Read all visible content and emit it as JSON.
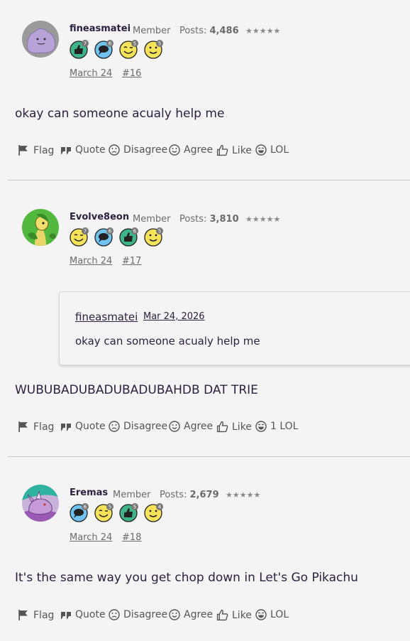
{
  "action_labels": {
    "flag": "Flag",
    "quote": "Quote",
    "disagree": "Disagree",
    "agree": "Agree",
    "like": "Like"
  },
  "icon_names": [
    "flag-icon",
    "quote-icon",
    "frown-icon",
    "smile-icon",
    "thumbs-up-icon",
    "laugh-icon"
  ],
  "posts": [
    {
      "username": "fineasmatei",
      "role": "Member",
      "posts_label": "Posts:",
      "posts_count": "4,486",
      "stars": "★★★★★",
      "badges": [
        {
          "kind": "thumbs",
          "color": "#3fb48a",
          "count": "7"
        },
        {
          "kind": "speech",
          "color": "#6fc3f0",
          "count": "6"
        },
        {
          "kind": "wink",
          "color": "#f7e35a",
          "count": "5"
        },
        {
          "kind": "smile",
          "color": "#f7e35a",
          "count": "5"
        }
      ],
      "date": "March 24",
      "number": "#16",
      "content": "okay can someone acualy help me",
      "lol_label": "LOL"
    },
    {
      "username": "Evolve8eon",
      "role": "Member",
      "posts_label": "Posts:",
      "posts_count": "3,810",
      "stars": "★★★★★",
      "badges": [
        {
          "kind": "wink",
          "color": "#f7e35a",
          "count": "7"
        },
        {
          "kind": "speech",
          "color": "#6fc3f0",
          "count": "6"
        },
        {
          "kind": "thumbs",
          "color": "#3fb48a",
          "count": "6"
        },
        {
          "kind": "smile",
          "color": "#f7e35a",
          "count": "5"
        }
      ],
      "date": "March 24",
      "number": "#17",
      "quote": {
        "user": "fineasmatei",
        "date": "Mar 24, 2026",
        "text": "okay can someone acualy help me"
      },
      "content": "WUBUBADUBADUBADUBAHDB DAT TRIE",
      "lol_label": "1 LOL"
    },
    {
      "username": "Eremas",
      "role": "Member",
      "posts_label": "Posts:",
      "posts_count": "2,679",
      "stars": "★★★★★",
      "badges": [
        {
          "kind": "speech",
          "color": "#6fc3f0",
          "count": "6"
        },
        {
          "kind": "wink",
          "color": "#f7e35a",
          "count": "5"
        },
        {
          "kind": "thumbs",
          "color": "#3fb48a",
          "count": "5"
        },
        {
          "kind": "smile",
          "color": "#f7e35a",
          "count": "4"
        }
      ],
      "date": "March 24",
      "number": "#18",
      "content": "It's the same way you get chop down in Let's Go Pikachu",
      "lol_label": "LOL"
    }
  ]
}
